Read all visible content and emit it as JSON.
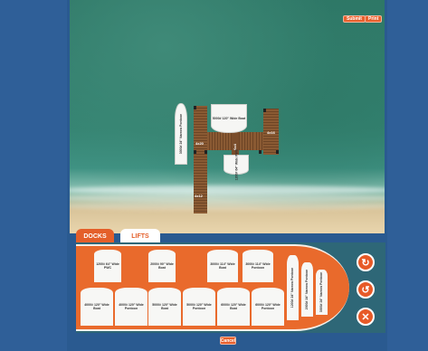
{
  "toolbar": {
    "submit_label": "Submit",
    "print_label": "Print"
  },
  "scene": {
    "dock_labels": [
      "4x20",
      "4x16",
      "4x12",
      "6x4"
    ],
    "placed_lifts": [
      "3000# 24\" Narrow Pontoon",
      "5000# 120\" Wide Boat",
      "1200# 64\" Wide PWC"
    ]
  },
  "tabs": {
    "docks_label": "DOCKS",
    "lifts_label": "LIFTS"
  },
  "tray": {
    "lifts_top": [
      "1200# 64\" Wide PWC",
      "2000# 90\" Wide Boat",
      "3000# 114\" Wide Boat",
      "3000# 114\" Wide Pontoon"
    ],
    "lifts_bottom": [
      "4000# 120\" Wide Boat",
      "4000# 120\" Wide Pontoon",
      "5000# 120\" Wide Boat",
      "5000# 120\" Wide Pontoon",
      "6000# 120\" Wide Boat",
      "6000# 120\" Wide Pontoon"
    ],
    "lifts_narrow": [
      "1200# 24\" Narrow Pontoon",
      "2000# 24\" Narrow Pontoon",
      "3000# 24\" Narrow Pontoon"
    ]
  },
  "actions": {
    "rotate_cw_icon": "rotate-cw-icon",
    "rotate_ccw_icon": "rotate-ccw-icon",
    "delete_icon": "close-icon",
    "cancel_label": "Cancel"
  }
}
